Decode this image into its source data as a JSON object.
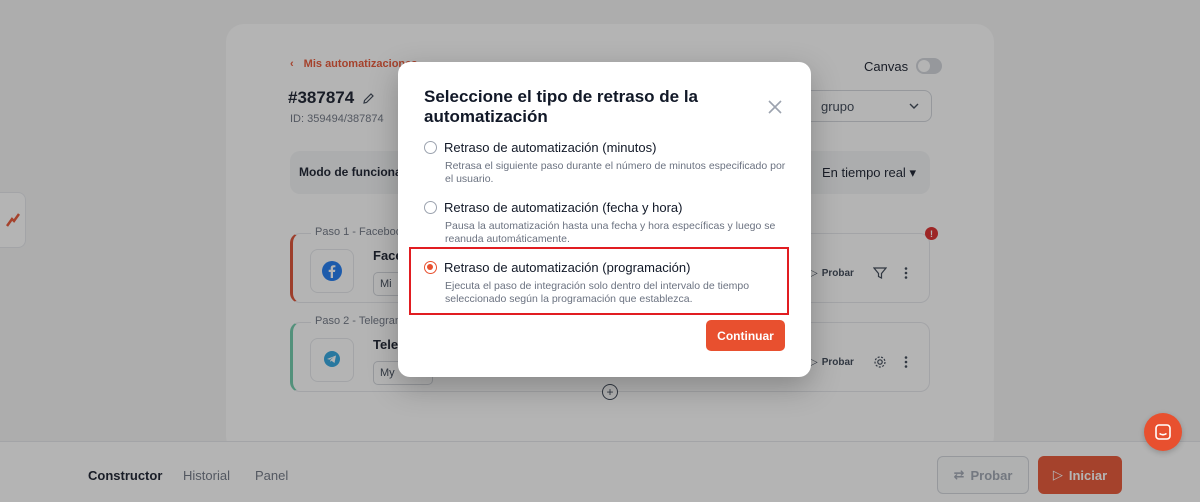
{
  "app": {
    "back_link": "Mis automatizaciones",
    "automation_title": "#387874",
    "automation_id": "ID: 359494/387874",
    "canvas_label": "Canvas",
    "group_select": "grupo",
    "mode_label": "Modo de funcionamiento",
    "mode_value": "En tiempo real",
    "steps": [
      {
        "tag": "Paso 1 - Facebook",
        "name": "Facebook",
        "sub": "Mi",
        "action": "Probar",
        "warning": "!"
      },
      {
        "tag": "Paso 2 - Telegram",
        "name": "Telegram",
        "sub": "My",
        "action": "Probar"
      }
    ],
    "add_step": "+"
  },
  "bottom_bar": {
    "tabs": [
      "Constructor",
      "Historial",
      "Panel"
    ],
    "probar": "Probar",
    "iniciar": "Iniciar"
  },
  "modal": {
    "title": "Seleccione el tipo de retraso de la automatización",
    "options": [
      {
        "label": "Retraso de automatización (minutos)",
        "description": "Retrasa el siguiente paso durante el número de minutos especificado por el usuario.",
        "selected": false
      },
      {
        "label": "Retraso de automatización (fecha y hora)",
        "description": "Pausa la automatización hasta una fecha y hora específicas y luego se reanuda automáticamente.",
        "selected": false
      },
      {
        "label": "Retraso de automatización (programación)",
        "description": "Ejecuta el paso de integración solo dentro del intervalo de tiempo seleccionado según la programación que establezca.",
        "selected": true
      }
    ],
    "continue_label": "Continuar"
  },
  "colors": {
    "accent": "#e8502f",
    "highlight": "#e11d21",
    "step1_border": "#dc4a2d",
    "step2_border": "#6ac9a8"
  }
}
